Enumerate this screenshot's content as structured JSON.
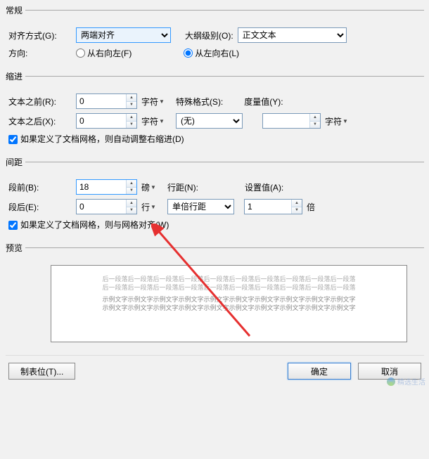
{
  "sections": {
    "general": "常规",
    "indent": "缩进",
    "spacing": "间距",
    "preview": "预览"
  },
  "general": {
    "alignLabel": "对齐方式(G):",
    "alignValue": "两端对齐",
    "outlineLabel": "大纲级别(O):",
    "outlineValue": "正文文本",
    "directionLabel": "方向:",
    "rtl": "从右向左(F)",
    "ltr": "从左向右(L)"
  },
  "indent": {
    "beforeLabel": "文本之前(R):",
    "beforeValue": "0",
    "beforeUnit": "字符",
    "afterLabel": "文本之后(X):",
    "afterValue": "0",
    "afterUnit": "字符",
    "specialLabel": "特殊格式(S):",
    "specialValue": "(无)",
    "measureLabel": "度量值(Y):",
    "measureUnit": "字符",
    "gridCheck": "如果定义了文档网格，则自动调整右缩进(D)"
  },
  "spacing": {
    "beforeLabel": "段前(B):",
    "beforeValue": "18",
    "beforeUnit": "磅",
    "afterLabel": "段后(E):",
    "afterValue": "0",
    "afterUnit": "行",
    "lineLabel": "行距(N):",
    "lineValue": "单倍行距",
    "setLabel": "设置值(A):",
    "setValue": "1",
    "setUnit": "倍",
    "gridCheck": "如果定义了文档网格，则与网格对齐(W)"
  },
  "preview": {
    "line1": "后一段落后一段落后一段落后一段落后一段落后一段落后一段落后一段落后一段落后一段落",
    "line2": "后一段落后一段落后一段落后一段落后一段落后一段落后一段落后一段落后一段落后一段落",
    "line3": "示例文字示例文字示例文字示例文字示例文字示例文字示例文字示例文字示例文字示例文字",
    "line4": "示例文字示例文字示例文字示例文字示例文字示例文字示例文字示例文字示例文字示例文字"
  },
  "buttons": {
    "tabs": "制表位(T)...",
    "ok": "确定",
    "cancel": "取消"
  },
  "watermark": "精选生活"
}
